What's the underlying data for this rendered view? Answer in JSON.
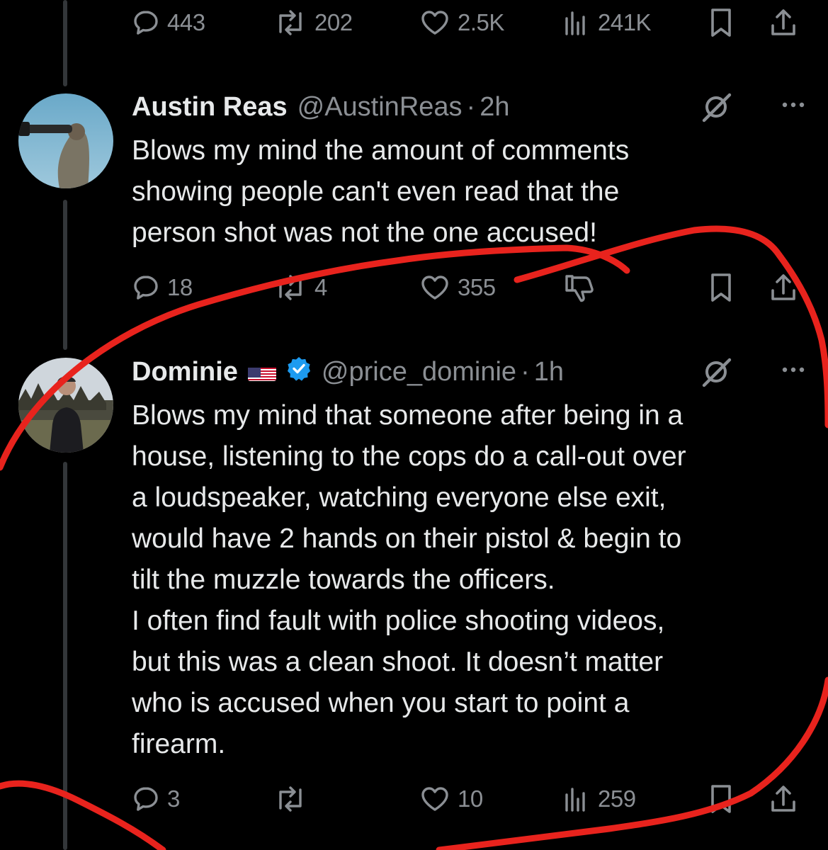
{
  "top_actions": {
    "replies": "443",
    "reposts": "202",
    "likes": "2.5K",
    "views": "241K"
  },
  "tweets": [
    {
      "author": "Austin Reas",
      "handle": "@AustinReas",
      "separator": "·",
      "time": "2h",
      "text": "Blows my mind the amount of comments\nshowing people can't even read that the\nperson shot was not the one accused!",
      "replies": "18",
      "reposts": "4",
      "likes": "355"
    },
    {
      "author": "Dominie",
      "handle": "@price_dominie",
      "separator": "·",
      "time": "1h",
      "text": "Blows my mind that someone after being in a\nhouse, listening to the cops do a call-out over\na loudspeaker, watching everyone else exit,\nwould have 2 hands on their pistol & begin to\ntilt the muzzle towards the officers.\nI often find fault with police shooting videos,\nbut this was a clean shoot. It doesn’t matter\nwho is accused when you start to point a\nfirearm.",
      "replies": "3",
      "likes": "10",
      "views": "259"
    }
  ],
  "colors": {
    "background": "#000000",
    "text": "#e7e9ea",
    "muted": "#8b8f94",
    "verified": "#1d9bf0",
    "annotation": "#e8231d"
  }
}
